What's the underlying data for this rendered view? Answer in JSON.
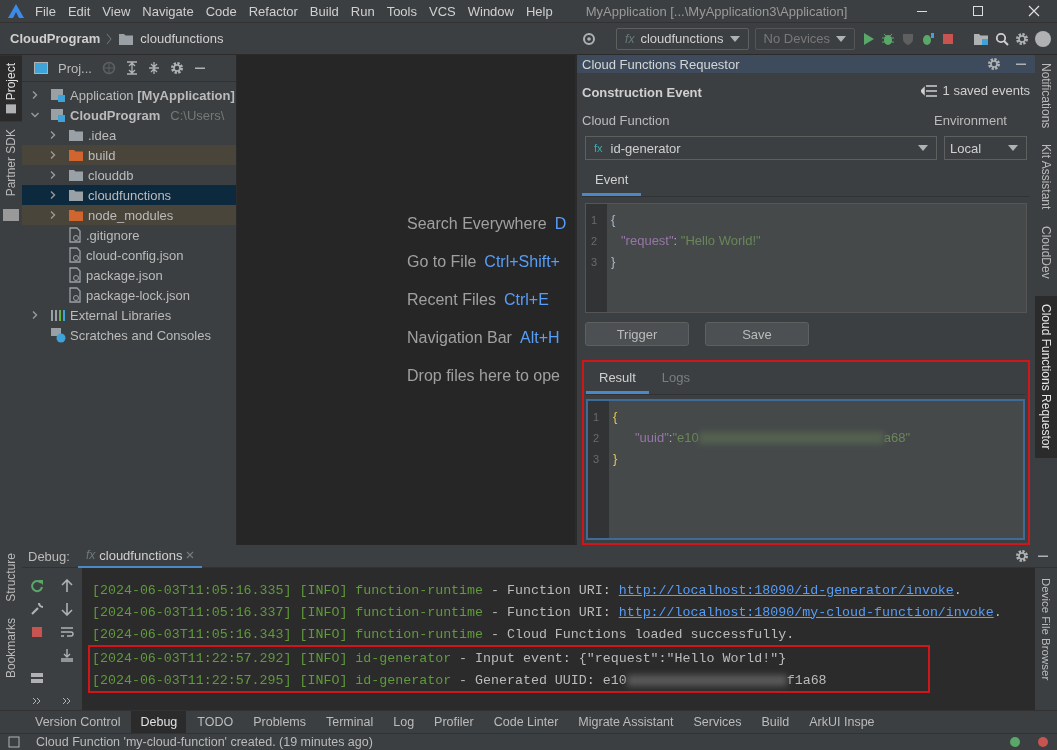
{
  "menu_bar": {
    "items": [
      "File",
      "Edit",
      "View",
      "Navigate",
      "Code",
      "Refactor",
      "Build",
      "Run",
      "Tools",
      "VCS",
      "Window",
      "Help"
    ],
    "title": "MyApplication [...\\MyApplication3\\Application]"
  },
  "nav_bar": {
    "breadcrumbs": [
      "CloudProgram",
      "cloudfunctions"
    ],
    "run_config_icon": "fx",
    "run_config": "cloudfunctions",
    "device": "No Devices"
  },
  "left_stripe": [
    {
      "label": "Project",
      "selected": true
    },
    {
      "label": "Partner SDK",
      "selected": false
    }
  ],
  "project_panel": {
    "title": "Proj...",
    "tree": [
      {
        "label": "Application **[MyApplication]**",
        "kind": "module",
        "expanded": false,
        "selected": false,
        "excluded": false
      },
      {
        "label": "CloudProgram",
        "hint": "C:\\Users\\",
        "kind": "module",
        "expanded": true,
        "selected": false,
        "excluded": false,
        "children": [
          {
            "label": ".idea",
            "kind": "folder",
            "expanded": false,
            "selected": false,
            "excluded": false
          },
          {
            "label": "build",
            "kind": "folder",
            "expanded": false,
            "selected": false,
            "excluded": true
          },
          {
            "label": "clouddb",
            "kind": "folder",
            "expanded": false,
            "selected": false,
            "excluded": false
          },
          {
            "label": "cloudfunctions",
            "kind": "folder",
            "expanded": false,
            "selected": true,
            "excluded": false
          },
          {
            "label": "node_modules",
            "kind": "folder",
            "expanded": false,
            "selected": false,
            "excluded": true
          },
          {
            "label": ".gitignore",
            "kind": "file",
            "selected": false,
            "excluded": false
          },
          {
            "label": "cloud-config.json",
            "kind": "file",
            "selected": false,
            "excluded": false
          },
          {
            "label": "package.json",
            "kind": "file",
            "selected": false,
            "excluded": false
          },
          {
            "label": "package-lock.json",
            "kind": "file",
            "selected": false,
            "excluded": false
          }
        ]
      },
      {
        "label": "External Libraries",
        "kind": "library",
        "expanded": false,
        "selected": false,
        "excluded": false
      },
      {
        "label": "Scratches and Consoles",
        "kind": "scratch",
        "selected": false,
        "excluded": false
      }
    ]
  },
  "welcome": [
    {
      "label": "Search Everywhere",
      "shortcut": "D"
    },
    {
      "label": "Go to File",
      "shortcut": "Ctrl+Shift+"
    },
    {
      "label": "Recent Files",
      "shortcut": "Ctrl+E"
    },
    {
      "label": "Navigation Bar",
      "shortcut": "Alt+H"
    },
    {
      "label": "Drop files here to ope"
    }
  ],
  "requestor": {
    "title": "Cloud Functions Requestor",
    "heading": "Construction Event",
    "saved_events": "1 saved events",
    "function_label": "Cloud Function",
    "environment_label": "Environment",
    "function_icon": "fx",
    "function": "id-generator",
    "environment": "Local",
    "event_tabs": [
      {
        "label": "Event",
        "selected": true
      }
    ],
    "event_code": [
      {
        "number": "1",
        "text": "{"
      },
      {
        "number": "2",
        "key": "\"request\"",
        "sep": ": ",
        "value": "\"Hello World!\""
      },
      {
        "number": "3",
        "text": "}"
      }
    ],
    "buttons": [
      "Trigger",
      "Save"
    ],
    "result_highlighted": true,
    "result_tabs": [
      {
        "label": "Result",
        "selected": true
      },
      {
        "label": "Logs",
        "selected": false
      }
    ],
    "result_code": [
      {
        "number": "1",
        "text": "{"
      },
      {
        "number": "2",
        "key": "\"uuid\"",
        "sep": ":",
        "value": "\"e10",
        "value_end": "a68\""
      },
      {
        "number": "3",
        "text": "}"
      }
    ]
  },
  "right_stripe": [
    {
      "label": "Notifications",
      "selected": false
    },
    {
      "label": "Kit Assistant",
      "selected": false
    },
    {
      "label": "CloudDev",
      "selected": false
    },
    {
      "label": "Cloud Functions Requestor",
      "selected": true
    }
  ],
  "debug": {
    "title": "Debug:",
    "tab_icon": "fx",
    "tab": "cloudfunctions",
    "log": [
      {
        "time": "[2024-06-03T11:05:16.335]",
        "level": "[INFO]",
        "source": "function-runtime",
        "message": " - Function URI: ",
        "link": "http://localhost:18090/id-generator/invoke",
        "tail": ".",
        "highlighted": false
      },
      {
        "time": "[2024-06-03T11:05:16.337]",
        "level": "[INFO]",
        "source": "function-runtime",
        "message": " - Function URI: ",
        "link": "http://localhost:18090/my-cloud-function/invoke",
        "tail": ".",
        "highlighted": false
      },
      {
        "time": "[2024-06-03T11:05:16.343]",
        "level": "[INFO]",
        "source": "function-runtime",
        "message": " - Cloud Functions loaded successfully.",
        "highlighted": false
      },
      {
        "time": "[2024-06-03T11:22:57.292]",
        "level": "[INFO]",
        "source": "id-generator",
        "message": " - Input event: {\"request\":\"Hello World!\"}",
        "highlighted": true
      },
      {
        "time": "[2024-06-03T11:22:57.295]",
        "level": "[INFO]",
        "source": "id-generator",
        "message": " - Generated UUID: e10",
        "tail": "f1a68",
        "redacted": true,
        "highlighted": true
      }
    ]
  },
  "bottom_left_stripe": [
    "Structure",
    "Bookmarks"
  ],
  "tool_tabs": [
    {
      "label": "Version Control",
      "selected": false
    },
    {
      "label": "Debug",
      "selected": true
    },
    {
      "label": "TODO",
      "selected": false
    },
    {
      "label": "Problems",
      "selected": false
    },
    {
      "label": "Terminal",
      "selected": false
    },
    {
      "label": "Log",
      "selected": false
    },
    {
      "label": "Profiler",
      "selected": false
    },
    {
      "label": "Code Linter",
      "selected": false
    },
    {
      "label": "Migrate Assistant",
      "selected": false
    },
    {
      "label": "Services",
      "selected": false
    },
    {
      "label": "Build",
      "selected": false
    },
    {
      "label": "ArkUI Inspe",
      "selected": false
    }
  ],
  "right_bottom_stripe": [
    "Device File Browser"
  ],
  "status_bar": {
    "message": "Cloud Function 'my-cloud-function' created. (19 minutes ago)"
  }
}
